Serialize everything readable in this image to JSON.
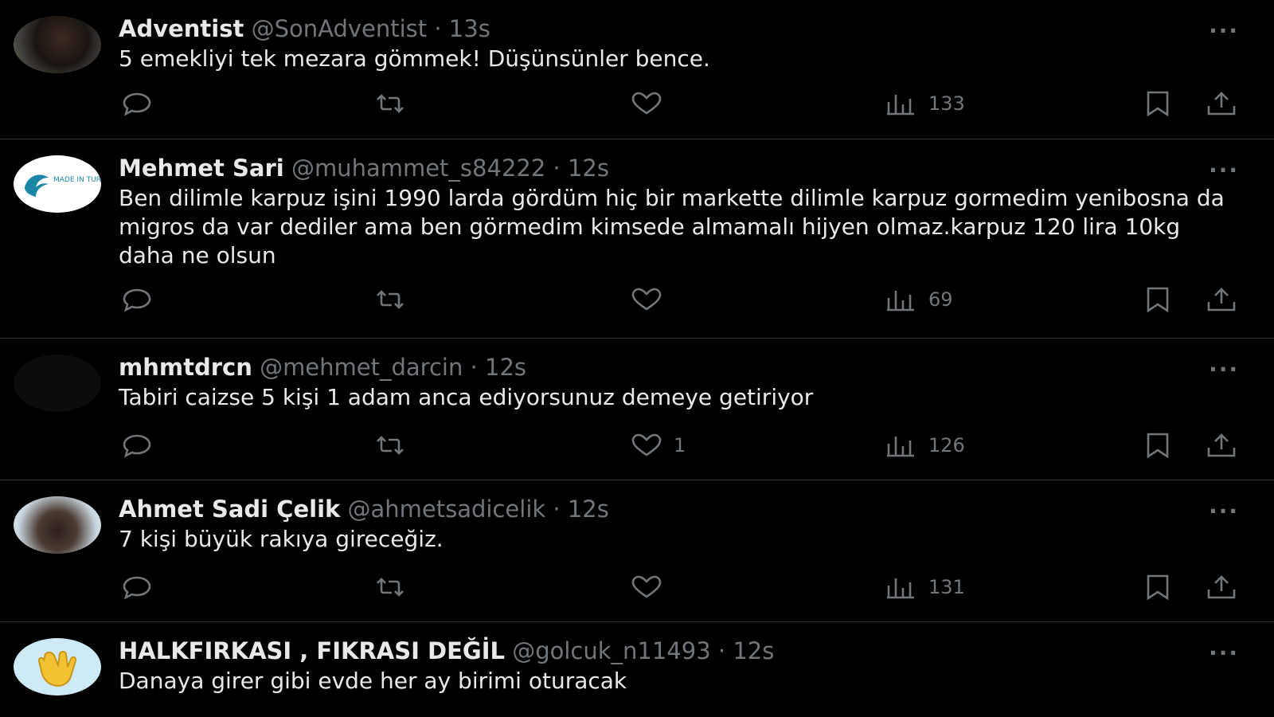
{
  "tweets": [
    {
      "name": "Adventist",
      "handle": "@SonAdventist",
      "time": "13s",
      "text": "5 emekliyi tek mezara gömmek! Düşünsünler bence.",
      "likes": "",
      "views": "133"
    },
    {
      "name": "Mehmet Sari",
      "handle": "@muhammet_s84222",
      "time": "12s",
      "text": "Ben dilimle karpuz işini 1990 larda gördüm hiç bir markette dilimle karpuz gormedim yenibosna da migros da var dediler ama ben görmedim kimsede almamalı hijyen olmaz.karpuz 120 lira 10kg daha ne olsun",
      "likes": "",
      "views": "69",
      "avatar_text": "MADE IN TURAN"
    },
    {
      "name": "mhmtdrcn",
      "handle": "@mehmet_darcin",
      "time": "12s",
      "text": "Tabiri caizse 5 kişi 1 adam anca ediyorsunuz demeye getiriyor",
      "likes": "1",
      "views": "126"
    },
    {
      "name": "Ahmet Sadi Çelik",
      "handle": "@ahmetsadicelik",
      "time": "12s",
      "text": "7 kişi büyük rakıya gireceğiz.",
      "likes": "",
      "views": "131"
    },
    {
      "name": "HALKFIRKASI , FIKRASI DEĞİL",
      "handle": "@golcuk_n11493",
      "time": "12s",
      "text": "Danaya girer gibi evde her ay birimi oturacak",
      "likes": "",
      "views": ""
    }
  ],
  "separator": "·",
  "more_glyph": "···",
  "icons": [
    "reply-icon",
    "retweet-icon",
    "like-icon",
    "views-icon",
    "bookmark-icon",
    "share-icon"
  ],
  "colors": {
    "background": "#000000",
    "text": "#e7e9ea",
    "muted": "#71767b",
    "border": "#2f3336"
  }
}
